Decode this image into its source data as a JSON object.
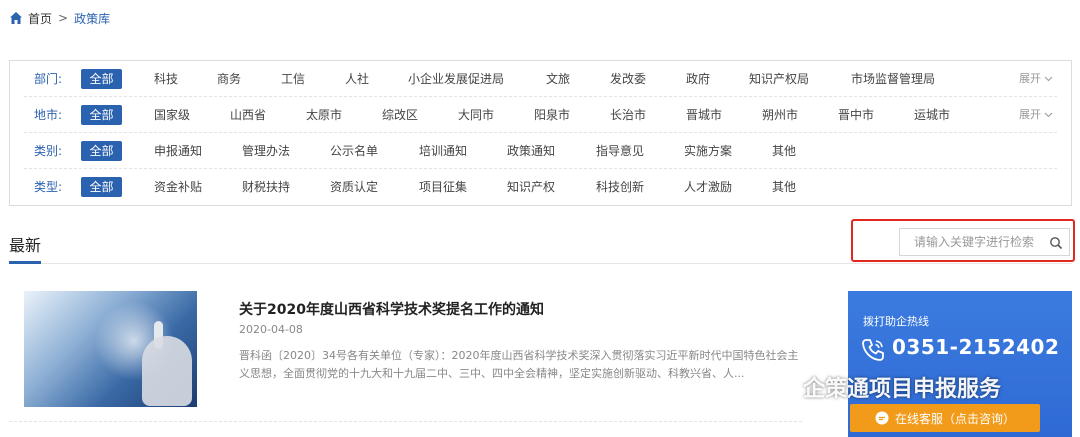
{
  "breadcrumb": {
    "home": "首页",
    "separator": ">",
    "current": "政策库"
  },
  "filters": {
    "expand_label": "展开",
    "rows": [
      {
        "label": "部门:",
        "options": [
          "全部",
          "科技",
          "商务",
          "工信",
          "人社",
          "小企业发展促进局",
          "文旅",
          "发改委",
          "政府",
          "知识产权局",
          "市场监督管理局"
        ],
        "expandable": true
      },
      {
        "label": "地市:",
        "options": [
          "全部",
          "国家级",
          "山西省",
          "太原市",
          "综改区",
          "大同市",
          "阳泉市",
          "长治市",
          "晋城市",
          "朔州市",
          "晋中市",
          "运城市"
        ],
        "expandable": true
      },
      {
        "label": "类别:",
        "options": [
          "全部",
          "申报通知",
          "管理办法",
          "公示名单",
          "培训通知",
          "政策通知",
          "指导意见",
          "实施方案",
          "其他"
        ],
        "expandable": false
      },
      {
        "label": "类型:",
        "options": [
          "全部",
          "资金补贴",
          "财税扶持",
          "资质认定",
          "项目征集",
          "知识产权",
          "科技创新",
          "人才激励",
          "其他"
        ],
        "expandable": false
      }
    ]
  },
  "latest": {
    "title": "最新"
  },
  "search": {
    "placeholder": "请输入关键字进行检索"
  },
  "article": {
    "title": "关于2020年度山西省科学技术奖提名工作的通知",
    "date": "2020-04-08",
    "summary": "晋科函〔2020〕34号各有关单位（专家）：2020年度山西省科学技术奖深入贯彻落实习近平新时代中国特色社会主义思想，全面贯彻党的十九大和十九届二中、三中、四中全会精神，坚定实施创新驱动、科教兴省、人..."
  },
  "hotline": {
    "label": "拨打助企热线",
    "number": "0351-2152402",
    "online_button": "在线客服（点击咨询）"
  },
  "watermark": {
    "text": "企策通项目申报服务"
  },
  "colors": {
    "accent": "#2b62b0",
    "highlight": "#e0281e",
    "hotline_bg": "#3b7bdf",
    "button_orange": "#f29b1a"
  }
}
